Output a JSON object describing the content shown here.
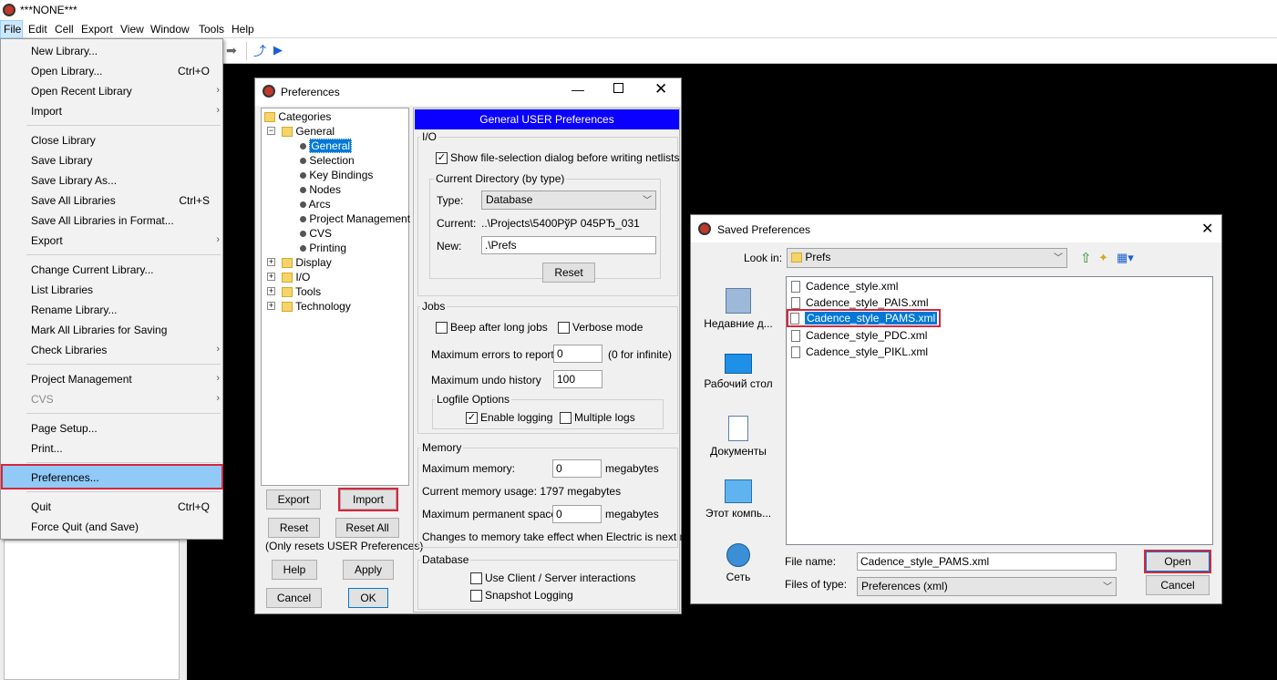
{
  "app": {
    "title": "***NONE***"
  },
  "menubar": [
    "File",
    "Edit",
    "Cell",
    "Export",
    "View",
    "Window",
    "Tools",
    "Help"
  ],
  "file_menu": {
    "items": [
      {
        "label": "New Library...",
        "shortcut": "",
        "submenu": false
      },
      {
        "label": "Open Library...",
        "shortcut": "Ctrl+O",
        "submenu": false
      },
      {
        "label": "Open Recent Library",
        "shortcut": "",
        "submenu": true
      },
      {
        "label": "Import",
        "shortcut": "",
        "submenu": true
      },
      {
        "label": "Close Library",
        "shortcut": "",
        "submenu": false
      },
      {
        "label": "Save Library",
        "shortcut": "",
        "submenu": false
      },
      {
        "label": "Save Library As...",
        "shortcut": "",
        "submenu": false
      },
      {
        "label": "Save All Libraries",
        "shortcut": "Ctrl+S",
        "submenu": false
      },
      {
        "label": "Save All Libraries in Format...",
        "shortcut": "",
        "submenu": false
      },
      {
        "label": "Export",
        "shortcut": "",
        "submenu": true
      },
      {
        "label": "Change Current Library...",
        "shortcut": "",
        "submenu": false
      },
      {
        "label": "List Libraries",
        "shortcut": "",
        "submenu": false
      },
      {
        "label": "Rename Library...",
        "shortcut": "",
        "submenu": false
      },
      {
        "label": "Mark All Libraries for Saving",
        "shortcut": "",
        "submenu": false
      },
      {
        "label": "Check Libraries",
        "shortcut": "",
        "submenu": true
      },
      {
        "label": "Project Management",
        "shortcut": "",
        "submenu": true
      },
      {
        "label": "CVS",
        "shortcut": "",
        "submenu": true
      },
      {
        "label": "Page Setup...",
        "shortcut": "",
        "submenu": false
      },
      {
        "label": "Print...",
        "shortcut": "",
        "submenu": false
      },
      {
        "label": "Preferences...",
        "shortcut": "",
        "submenu": false
      },
      {
        "label": "Quit",
        "shortcut": "Ctrl+Q",
        "submenu": false
      },
      {
        "label": "Force Quit (and Save)",
        "shortcut": "",
        "submenu": false
      }
    ]
  },
  "preferences": {
    "title": "Preferences",
    "tree": {
      "root": "Categories",
      "general": "General",
      "general_children": [
        "General",
        "Selection",
        "Key Bindings",
        "Nodes",
        "Arcs",
        "Project Management",
        "CVS",
        "Printing"
      ],
      "others": [
        "Display",
        "I/O",
        "Tools",
        "Technology"
      ]
    },
    "buttons": {
      "export": "Export",
      "import": "Import",
      "reset": "Reset",
      "reset_all": "Reset All",
      "reset_note": "(Only resets USER Preferences)",
      "help": "Help",
      "apply": "Apply",
      "cancel": "Cancel",
      "ok": "OK"
    },
    "header": "General USER Preferences",
    "io": {
      "label": "I/O",
      "show_dialog": "Show file-selection dialog before writing netlists",
      "current_dir_label": "Current Directory (by type)",
      "type_label": "Type:",
      "type_value": "Database",
      "current_label": "Current:",
      "current_value": "..\\Projects\\5400РўР 045РЂ_031",
      "new_label": "New:",
      "new_value": ".\\Prefs",
      "reset": "Reset"
    },
    "jobs": {
      "label": "Jobs",
      "beep": "Beep after long jobs",
      "verbose": "Verbose mode",
      "max_errors_label": "Maximum errors to report:",
      "max_errors_value": "0",
      "max_errors_note": "(0 for infinite)",
      "max_undo_label": "Maximum undo history",
      "max_undo_value": "100",
      "logfile_label": "Logfile Options",
      "enable_logging": "Enable logging",
      "multiple_logs": "Multiple logs"
    },
    "memory": {
      "label": "Memory",
      "max_mem_label": "Maximum memory:",
      "max_mem_value": "0",
      "unit": "megabytes",
      "usage": "Current memory usage: 1797 megabytes",
      "max_perm_label": "Maximum permanent space:",
      "max_perm_value": "0",
      "note": "Changes to memory take effect when Electric is next run"
    },
    "database": {
      "label": "Database",
      "client_server": "Use Client / Server interactions",
      "snapshot": "Snapshot Logging"
    }
  },
  "saved_prefs": {
    "title": "Saved Preferences",
    "look_in_label": "Look in:",
    "look_in_value": "Prefs",
    "places": [
      "Недавние д...",
      "Рабочий стол",
      "Документы",
      "Этот компь...",
      "Сеть"
    ],
    "files": [
      "Cadence_style.xml",
      "Cadence_style_PAIS.xml",
      "Cadence_style_PAMS.xml",
      "Cadence_style_PDC.xml",
      "Cadence_style_PIKL.xml"
    ],
    "file_name_label": "File name:",
    "file_name_value": "Cadence_style_PAMS.xml",
    "file_type_label": "Files of type:",
    "file_type_value": "Preferences (xml)",
    "open": "Open",
    "cancel": "Cancel"
  },
  "colors": {
    "accent": "#0a00ff",
    "selection": "#0078d7",
    "highlight": "#d7263d"
  }
}
